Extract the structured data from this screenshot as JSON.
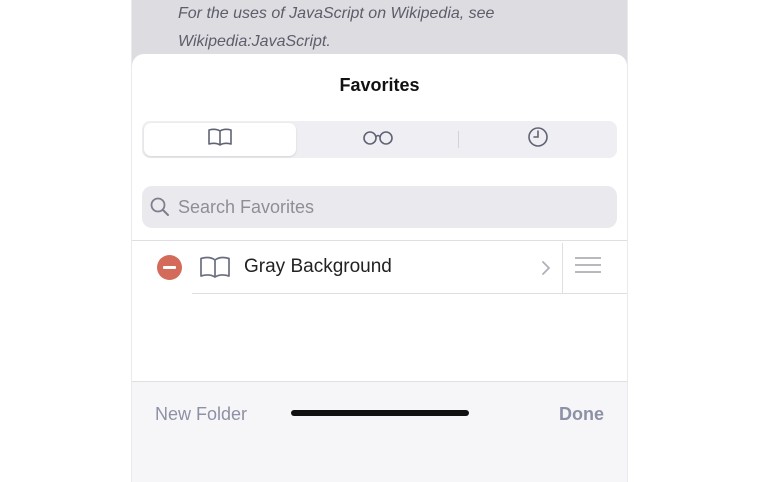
{
  "background_page": {
    "line1": "For the uses of JavaScript on Wikipedia, see",
    "line2": "Wikipedia:JavaScript."
  },
  "sheet": {
    "title": "Favorites",
    "segments": [
      {
        "icon": "book-icon",
        "selected": true
      },
      {
        "icon": "glasses-icon",
        "selected": false
      },
      {
        "icon": "clock-icon",
        "selected": false
      }
    ],
    "search": {
      "placeholder": "Search Favorites",
      "value": ""
    },
    "items": [
      {
        "label": "Gray Background",
        "icon": "book-icon"
      }
    ],
    "toolbar": {
      "new_folder_label": "New Folder",
      "done_label": "Done"
    }
  },
  "colors": {
    "delete": "#d46a5a",
    "toolbar_text": "#8d91a6",
    "icon": "#5f6374"
  }
}
